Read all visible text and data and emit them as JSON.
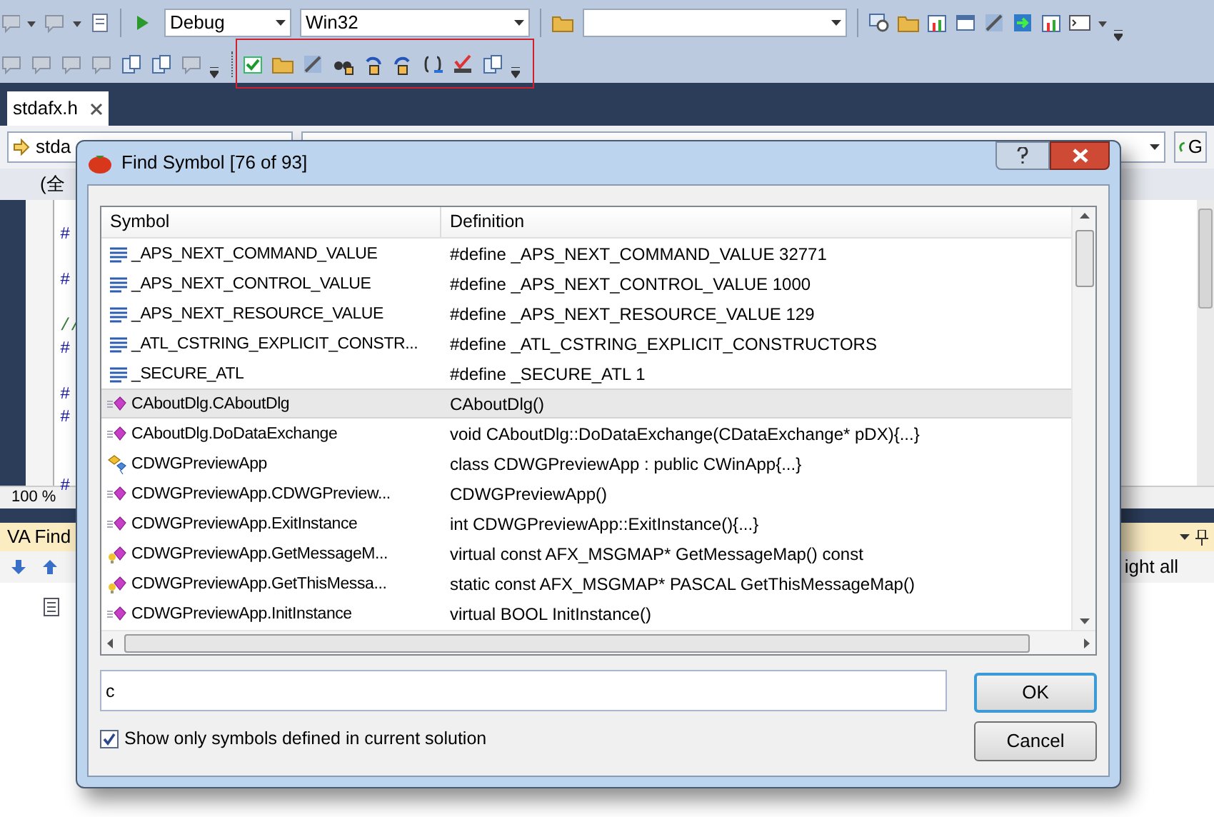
{
  "toolbar": {
    "configuration": "Debug",
    "platform": "Win32"
  },
  "document_tab": {
    "label": "stdafx.h",
    "selected": true
  },
  "navigation": {
    "file": "stda",
    "scope": "(全",
    "go_button": "G"
  },
  "editor": {
    "code_fragments": [
      {
        "text": "#",
        "kind": "directive"
      },
      {
        "text": "#",
        "kind": "directive"
      },
      {
        "text": "//",
        "kind": "comment"
      },
      {
        "text": "#",
        "kind": "directive"
      },
      {
        "text": "#",
        "kind": "directive"
      },
      {
        "text": "#",
        "kind": "directive"
      },
      {
        "text": "#",
        "kind": "directive"
      }
    ],
    "zoom": "100 %"
  },
  "va_find_panel": {
    "title": "VA Find",
    "highlight_label": "ight all"
  },
  "dialog": {
    "title": "Find Symbol [76 of 93]",
    "columns": [
      "Symbol",
      "Definition"
    ],
    "rows": [
      {
        "symbol": "_APS_NEXT_COMMAND_VALUE",
        "definition": "#define _APS_NEXT_COMMAND_VALUE 32771",
        "kind": "macro",
        "selected": false
      },
      {
        "symbol": "_APS_NEXT_CONTROL_VALUE",
        "definition": "#define _APS_NEXT_CONTROL_VALUE 1000",
        "kind": "macro",
        "selected": false
      },
      {
        "symbol": "_APS_NEXT_RESOURCE_VALUE",
        "definition": "#define _APS_NEXT_RESOURCE_VALUE 129",
        "kind": "macro",
        "selected": false
      },
      {
        "symbol": "_ATL_CSTRING_EXPLICIT_CONSTR...",
        "definition": "#define _ATL_CSTRING_EXPLICIT_CONSTRUCTORS",
        "kind": "macro",
        "selected": false
      },
      {
        "symbol": "_SECURE_ATL",
        "definition": "#define _SECURE_ATL 1",
        "kind": "macro",
        "selected": false
      },
      {
        "symbol": "CAboutDlg.CAboutDlg",
        "definition": "CAboutDlg()",
        "kind": "method",
        "selected": true
      },
      {
        "symbol": "CAboutDlg.DoDataExchange",
        "definition": "void CAboutDlg::DoDataExchange(CDataExchange* pDX){...}",
        "kind": "method",
        "selected": false
      },
      {
        "symbol": "CDWGPreviewApp",
        "definition": "class CDWGPreviewApp : public CWinApp{...}",
        "kind": "class",
        "selected": false
      },
      {
        "symbol": "CDWGPreviewApp.CDWGPreview...",
        "definition": "CDWGPreviewApp()",
        "kind": "method",
        "selected": false
      },
      {
        "symbol": "CDWGPreviewApp.ExitInstance",
        "definition": "int CDWGPreviewApp::ExitInstance(){...}",
        "kind": "method",
        "selected": false
      },
      {
        "symbol": "CDWGPreviewApp.GetMessageM...",
        "definition": "virtual const AFX_MSGMAP* GetMessageMap() const",
        "kind": "virtual_method",
        "selected": false
      },
      {
        "symbol": "CDWGPreviewApp.GetThisMessa...",
        "definition": "static const AFX_MSGMAP* PASCAL GetThisMessageMap()",
        "kind": "virtual_method",
        "selected": false
      },
      {
        "symbol": "CDWGPreviewApp.InitInstance",
        "definition": "virtual BOOL InitInstance()",
        "kind": "method",
        "selected": false
      }
    ],
    "filter_value": "c",
    "option": {
      "label": "Show only symbols defined in current solution",
      "checked": true
    },
    "buttons": [
      {
        "label": "OK",
        "default": true
      },
      {
        "label": "Cancel",
        "default": false
      }
    ]
  }
}
